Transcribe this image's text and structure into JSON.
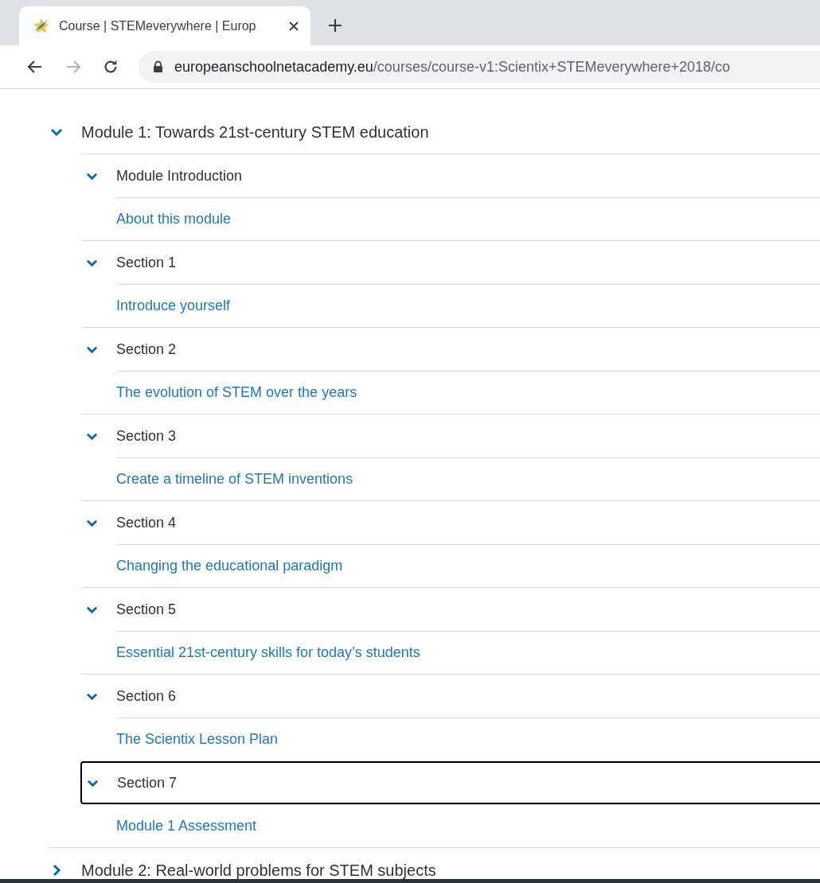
{
  "browser": {
    "tab": {
      "title": "Course | STEMeverywhere | Europ",
      "selected": true
    },
    "nav": {
      "back_disabled": false,
      "forward_disabled": true
    },
    "address": {
      "host": "europeanschoolnetacademy.eu",
      "path": "/courses/course-v1:Scientix+STEMeverywhere+2018/co"
    }
  },
  "outline": [
    {
      "title": "Module 1: Towards 21st-century STEM education",
      "expanded": true,
      "children": [
        {
          "title": "Module Introduction",
          "expanded": true,
          "focused": false,
          "children": [
            {
              "title": "About this module"
            }
          ]
        },
        {
          "title": "Section 1",
          "expanded": true,
          "focused": false,
          "children": [
            {
              "title": "Introduce yourself"
            }
          ]
        },
        {
          "title": "Section 2",
          "expanded": true,
          "focused": false,
          "children": [
            {
              "title": "The evolution of STEM over the years"
            }
          ]
        },
        {
          "title": "Section 3",
          "expanded": true,
          "focused": false,
          "children": [
            {
              "title": "Create a timeline of STEM inventions"
            }
          ]
        },
        {
          "title": "Section 4",
          "expanded": true,
          "focused": false,
          "children": [
            {
              "title": "Changing the educational paradigm"
            }
          ]
        },
        {
          "title": "Section 5",
          "expanded": true,
          "focused": false,
          "children": [
            {
              "title": "Essential 21st-century skills for today’s students"
            }
          ]
        },
        {
          "title": "Section 6",
          "expanded": true,
          "focused": false,
          "children": [
            {
              "title": "The Scientix Lesson Plan"
            }
          ]
        },
        {
          "title": "Section 7",
          "expanded": true,
          "focused": true,
          "children": [
            {
              "title": "Module 1 Assessment"
            }
          ]
        }
      ]
    },
    {
      "title": "Module 2: Real-world problems for STEM subjects",
      "expanded": false
    }
  ]
}
